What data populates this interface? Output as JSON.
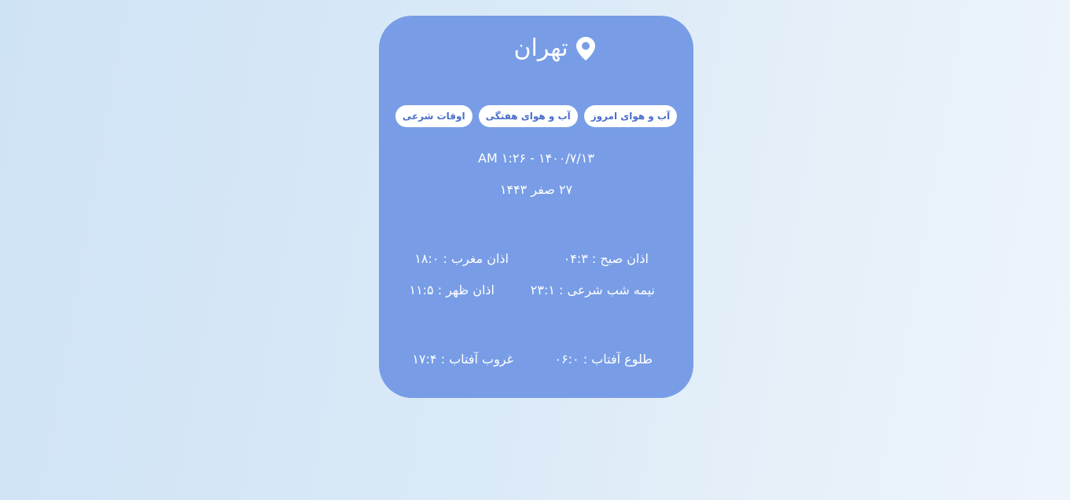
{
  "city": {
    "name": "تهران",
    "icon": "location-pin-icon"
  },
  "tabs": [
    {
      "label": "آب و هوای امروز"
    },
    {
      "label": "آب و هوای هفتگی"
    },
    {
      "label": "اوقات شرعی"
    }
  ],
  "date": {
    "solar_and_time": "۱۴۰۰/۷/۱۳ - ۱:۲۶ AM",
    "lunar": "۲۷ صفر ۱۴۴۳"
  },
  "prayer_times": {
    "fajr": "اذان صبح : ۰۴:۳",
    "maghrib": "اذان مغرب : ۱۸:۰",
    "midnight": "نیمه شب شرعی : ۲۳:۱",
    "dhuhr": "اذان ظهر : ۱۱:۵",
    "sunrise": "طلوع آفتاب : ۰۶:۰",
    "sunset": "غروب آفتاب : ۱۷:۴"
  },
  "colors": {
    "card_background": "#789de6",
    "tab_text": "#4a6fc8",
    "text": "#ffffff"
  }
}
